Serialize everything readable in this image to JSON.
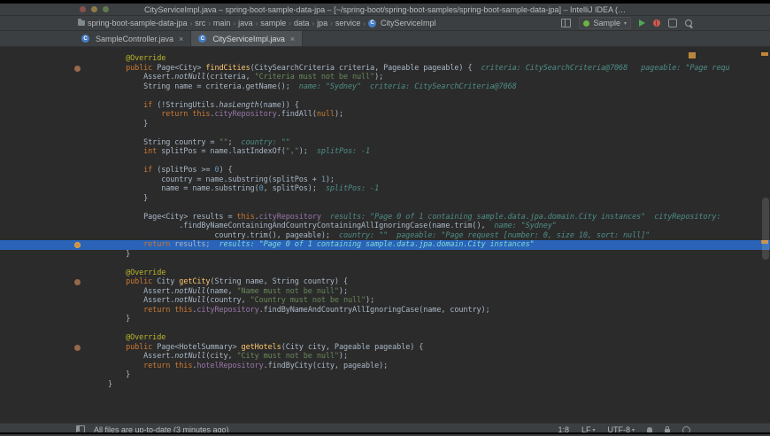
{
  "window": {
    "title": "CityServiceImpl.java – spring-boot-sample-data-jpa – [~/spring-boot/spring-boot-samples/spring-boot-sample-data-jpa] – IntelliJ IDEA (…"
  },
  "icons": {
    "class_letter": "C",
    "tab_close": "×",
    "chevron_down": "▾"
  },
  "navbar": {
    "separator": "›",
    "crumbs": [
      "spring-boot-sample-data-jpa",
      "src",
      "main",
      "java",
      "sample",
      "data",
      "jpa",
      "service",
      "CityServiceImpl"
    ],
    "run_config": "Sample"
  },
  "tabs": [
    {
      "label": "SampleController.java",
      "active": false
    },
    {
      "label": "CityServiceImpl.java",
      "active": true
    }
  ],
  "status": {
    "message": "All files are up-to-date (3 minutes ago)",
    "position": "1:8",
    "line_sep": "LF",
    "encoding": "UTF-8"
  },
  "colors": {
    "execution_line": "#2a63b8",
    "breakpoint": "#cf8f3a",
    "run_green": "#4fa65a"
  },
  "editor": {
    "lines": [
      {
        "s": [
          [
            "p",
            "    "
          ],
          [
            "a",
            "@Override"
          ]
        ]
      },
      {
        "g": "ov",
        "s": [
          [
            "p",
            "    "
          ],
          [
            "k",
            "public"
          ],
          [
            "p",
            " Page<City> "
          ],
          [
            "d",
            "findCities"
          ],
          [
            "p",
            "(CitySearchCriteria criteria, Pageable pageable) {  "
          ],
          [
            "g",
            "criteria: CitySearchCriteria@7068   pageable: \"Page requ"
          ]
        ]
      },
      {
        "s": [
          [
            "p",
            "        Assert."
          ],
          [
            "i",
            "notNull"
          ],
          [
            "p",
            "(criteria, "
          ],
          [
            "s",
            "\"Criteria must not be null\""
          ],
          [
            "p",
            ");"
          ]
        ]
      },
      {
        "s": [
          [
            "p",
            "        String name = criteria.getName();  "
          ],
          [
            "g",
            "name: \"Sydney\"  criteria: CitySearchCriteria@7068"
          ]
        ]
      },
      {
        "s": []
      },
      {
        "s": [
          [
            "p",
            "        "
          ],
          [
            "k",
            "if"
          ],
          [
            "p",
            " (!StringUtils."
          ],
          [
            "i",
            "hasLength"
          ],
          [
            "p",
            "(name)) {"
          ]
        ]
      },
      {
        "s": [
          [
            "p",
            "            "
          ],
          [
            "k",
            "return "
          ],
          [
            "k",
            "this"
          ],
          [
            "p",
            "."
          ],
          [
            "f",
            "cityRepository"
          ],
          [
            "p",
            ".findAll("
          ],
          [
            "k",
            "null"
          ],
          [
            "p",
            ");"
          ]
        ]
      },
      {
        "s": [
          [
            "p",
            "        }"
          ]
        ]
      },
      {
        "s": []
      },
      {
        "s": [
          [
            "p",
            "        String country = "
          ],
          [
            "s",
            "\"\""
          ],
          [
            "p",
            ";  "
          ],
          [
            "g",
            "country: \"\""
          ]
        ]
      },
      {
        "s": [
          [
            "p",
            "        "
          ],
          [
            "k",
            "int"
          ],
          [
            "p",
            " splitPos = name.lastIndexOf("
          ],
          [
            "s",
            "\",\""
          ],
          [
            "p",
            ");  "
          ],
          [
            "g",
            "splitPos: -1"
          ]
        ]
      },
      {
        "s": []
      },
      {
        "s": [
          [
            "p",
            "        "
          ],
          [
            "k",
            "if"
          ],
          [
            "p",
            " (splitPos >= "
          ],
          [
            "n",
            "0"
          ],
          [
            "p",
            ") {"
          ]
        ]
      },
      {
        "s": [
          [
            "p",
            "            country = name.substring(splitPos + "
          ],
          [
            "n",
            "1"
          ],
          [
            "p",
            ");"
          ]
        ]
      },
      {
        "s": [
          [
            "p",
            "            name = name.substring("
          ],
          [
            "n",
            "0"
          ],
          [
            "p",
            ", splitPos);  "
          ],
          [
            "g",
            "splitPos: -1"
          ]
        ]
      },
      {
        "s": [
          [
            "p",
            "        }"
          ]
        ]
      },
      {
        "s": []
      },
      {
        "s": [
          [
            "p",
            "        Page<City> results = "
          ],
          [
            "k",
            "this"
          ],
          [
            "p",
            "."
          ],
          [
            "f",
            "cityRepository"
          ],
          [
            "p",
            "  "
          ],
          [
            "g",
            "results: \"Page 0 of 1 containing sample.data.jpa.domain.City instances\"  cityRepository:"
          ]
        ]
      },
      {
        "s": [
          [
            "p",
            "                .findByNameContainingAndCountryContainingAllIgnoringCase(name.trim(),  "
          ],
          [
            "g",
            "name: \"Sydney\""
          ]
        ]
      },
      {
        "s": [
          [
            "p",
            "                        country.trim(), pageable);  "
          ],
          [
            "g",
            "country: \"\"  pageable: \"Page request [number: 0, size 10, sort: null]\""
          ]
        ]
      },
      {
        "hl": true,
        "g": "bp",
        "s": [
          [
            "p",
            "        "
          ],
          [
            "k",
            "return"
          ],
          [
            "p",
            " results;  "
          ],
          [
            "G",
            "results: \"Page 0 of 1 containing sample.data.jpa.domain.City instances\""
          ]
        ]
      },
      {
        "s": [
          [
            "p",
            "    }"
          ]
        ]
      },
      {
        "s": []
      },
      {
        "s": [
          [
            "p",
            "    "
          ],
          [
            "a",
            "@Override"
          ]
        ]
      },
      {
        "g": "ov",
        "s": [
          [
            "p",
            "    "
          ],
          [
            "k",
            "public"
          ],
          [
            "p",
            " City "
          ],
          [
            "d",
            "getCity"
          ],
          [
            "p",
            "(String name, String country) {"
          ]
        ]
      },
      {
        "s": [
          [
            "p",
            "        Assert."
          ],
          [
            "i",
            "notNull"
          ],
          [
            "p",
            "(name, "
          ],
          [
            "s",
            "\"Name must not be null\""
          ],
          [
            "p",
            ");"
          ]
        ]
      },
      {
        "s": [
          [
            "p",
            "        Assert."
          ],
          [
            "i",
            "notNull"
          ],
          [
            "p",
            "(country, "
          ],
          [
            "s",
            "\"Country must not be null\""
          ],
          [
            "p",
            ");"
          ]
        ]
      },
      {
        "s": [
          [
            "p",
            "        "
          ],
          [
            "k",
            "return "
          ],
          [
            "k",
            "this"
          ],
          [
            "p",
            "."
          ],
          [
            "f",
            "cityRepository"
          ],
          [
            "p",
            ".findByNameAndCountryAllIgnoringCase(name, country);"
          ]
        ]
      },
      {
        "s": [
          [
            "p",
            "    }"
          ]
        ]
      },
      {
        "s": []
      },
      {
        "s": [
          [
            "p",
            "    "
          ],
          [
            "a",
            "@Override"
          ]
        ]
      },
      {
        "g": "ov",
        "s": [
          [
            "p",
            "    "
          ],
          [
            "k",
            "public"
          ],
          [
            "p",
            " Page<HotelSummary> "
          ],
          [
            "d",
            "getHotels"
          ],
          [
            "p",
            "(City city, Pageable pageable) {"
          ]
        ]
      },
      {
        "s": [
          [
            "p",
            "        Assert."
          ],
          [
            "i",
            "notNull"
          ],
          [
            "p",
            "(city, "
          ],
          [
            "s",
            "\"City must not be null\""
          ],
          [
            "p",
            ");"
          ]
        ]
      },
      {
        "s": [
          [
            "p",
            "        "
          ],
          [
            "k",
            "return "
          ],
          [
            "k",
            "this"
          ],
          [
            "p",
            "."
          ],
          [
            "f",
            "hotelRepository"
          ],
          [
            "p",
            ".findByCity(city, pageable);"
          ]
        ]
      },
      {
        "s": [
          [
            "p",
            "    }"
          ]
        ]
      },
      {
        "s": [
          [
            "p",
            "}"
          ]
        ]
      }
    ]
  }
}
